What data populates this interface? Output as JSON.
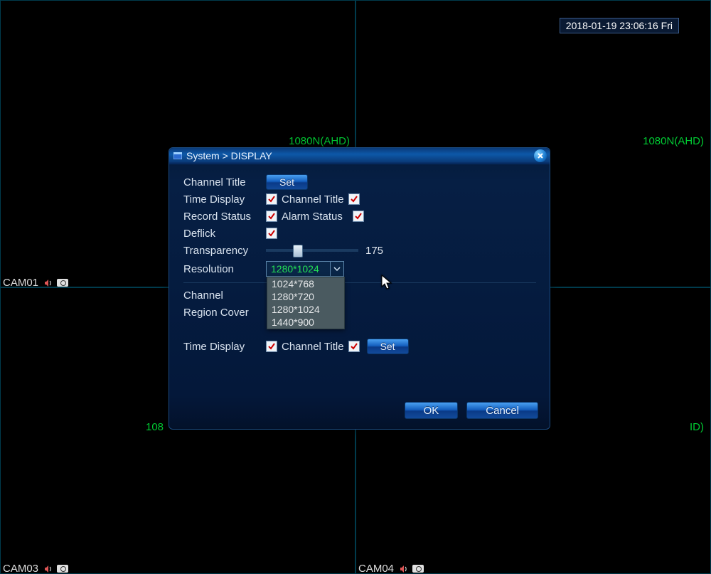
{
  "timestamp": "2018-01-19 23:06:16 Fri",
  "quad": {
    "res_tl": "1080N(AHD)",
    "res_tr": "1080N(AHD)",
    "res_bl": "108",
    "res_br": "ID)",
    "cam_tl": "CAM01",
    "cam_bl": "CAM03",
    "cam_br": "CAM04"
  },
  "dialog": {
    "title": "System > DISPLAY",
    "rows": {
      "channel_title": "Channel Title",
      "set": "Set",
      "time_display": "Time Display",
      "channel_title2": "Channel Title",
      "record_status": "Record Status",
      "alarm_status": "Alarm Status",
      "deflick": "Deflick",
      "transparency": "Transparency",
      "transparency_val": "175",
      "resolution": "Resolution",
      "resolution_val": "1280*1024",
      "channel": "Channel",
      "region_cover": "Region Cover",
      "time_display2": "Time Display",
      "channel_title3": "Channel Title",
      "set2": "Set"
    },
    "dropdown": [
      "1024*768",
      "1280*720",
      "1280*1024",
      "1440*900"
    ],
    "buttons": {
      "ok": "OK",
      "cancel": "Cancel"
    }
  }
}
